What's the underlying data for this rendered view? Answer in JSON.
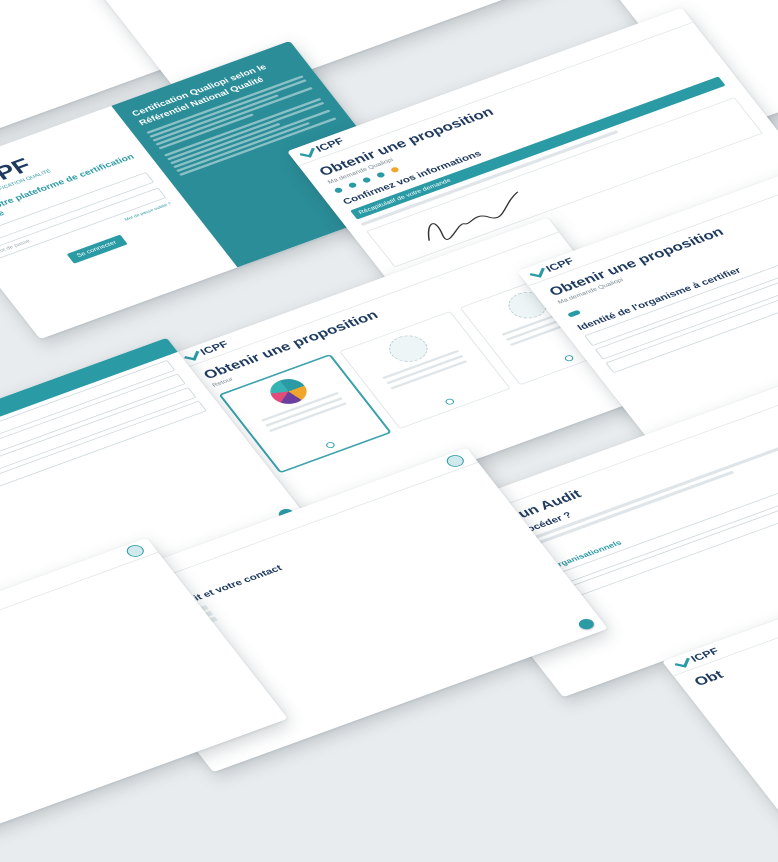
{
  "logo": {
    "brand": "ICPF",
    "caption": "CERTIFICATION QUALITÉ"
  },
  "login": {
    "tagline": "NCIÉ, votre plateforme de certification en ligne",
    "email_placeholder": "E-mail",
    "password_placeholder": "Mot de passe",
    "forgot_link": "Mot de passe oublié ?",
    "submit_label": "Se connecter",
    "panel_title": "Certification Qualiopi selon le Référentiel National Qualité"
  },
  "proposition": {
    "title": "Obtenir une proposition",
    "back_label": "Retour"
  },
  "confirm": {
    "title": "Obtenir une proposition",
    "subtitle": "Ma demande Qualiopi",
    "section": "Confirmez vos informations",
    "bar_label": "Récapitulatif de votre demande"
  },
  "identity": {
    "title": "Obtenir une proposition",
    "subtitle": "Ma demande Qualiopi",
    "section": "Identité de l'organisme à certifier"
  },
  "audit": {
    "title": "Planifier un Audit",
    "question": "Comment procéder ?",
    "section": "Changements organisationnels"
  },
  "dates": {
    "subtitle": "Ma demande Qualiopi",
    "section": "Vos dates d'audit et votre contact"
  },
  "stub": {
    "title": "Obt"
  },
  "colors": {
    "accent": "#2a9aa5",
    "navy": "#1e3a5f",
    "highlight": "#f0a52c"
  }
}
